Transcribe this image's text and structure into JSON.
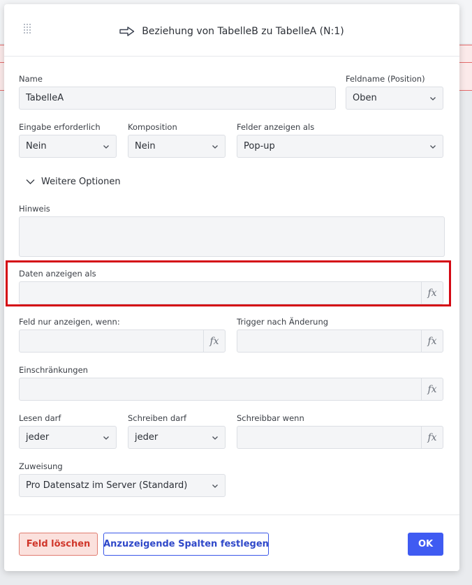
{
  "dialog": {
    "title": "Beziehung von TabelleB zu TabelleA (N:1)"
  },
  "form": {
    "name": {
      "label": "Name",
      "value": "TabelleA"
    },
    "feldname_position": {
      "label": "Feldname (Position)",
      "value": "Oben"
    },
    "eingabe_erforderlich": {
      "label": "Eingabe erforderlich",
      "value": "Nein"
    },
    "komposition": {
      "label": "Komposition",
      "value": "Nein"
    },
    "felder_anzeigen_als": {
      "label": "Felder anzeigen als",
      "value": "Pop-up"
    },
    "weitere_optionen": {
      "label": "Weitere Optionen"
    },
    "hinweis": {
      "label": "Hinweis",
      "value": ""
    },
    "daten_anzeigen_als": {
      "label": "Daten anzeigen als",
      "value": ""
    },
    "feld_nur_anzeigen_wenn": {
      "label": "Feld nur anzeigen, wenn:",
      "value": ""
    },
    "trigger_nach_aenderung": {
      "label": "Trigger nach Änderung",
      "value": ""
    },
    "einschraenkungen": {
      "label": "Einschränkungen",
      "value": ""
    },
    "lesen_darf": {
      "label": "Lesen darf",
      "value": "jeder"
    },
    "schreiben_darf": {
      "label": "Schreiben darf",
      "value": "jeder"
    },
    "schreibbar_wenn": {
      "label": "Schreibbar wenn",
      "value": ""
    },
    "zuweisung": {
      "label": "Zuweisung",
      "value": "Pro Datensatz im Server (Standard)"
    },
    "fx_label": "fx"
  },
  "footer": {
    "delete_label": "Feld löschen",
    "columns_label": "Anzuzeigende Spalten festlegen",
    "ok_label": "OK"
  },
  "icons": {
    "title_icon": "arrow-right-outline-icon",
    "dropdown_icon": "chevron-down-icon",
    "drag_icon": "drag-handle-icon"
  },
  "colors": {
    "highlight": "#d40914",
    "primary": "#3f5bf2",
    "danger": "#d0362a"
  }
}
